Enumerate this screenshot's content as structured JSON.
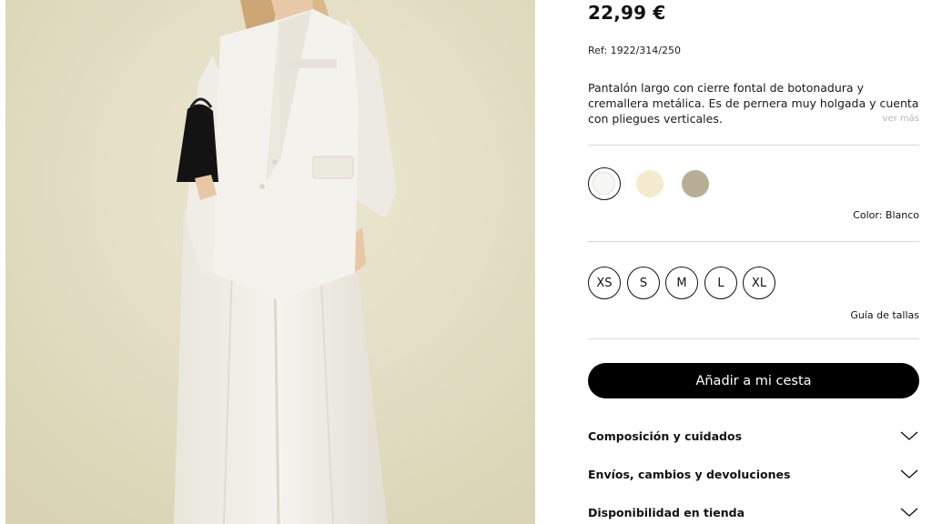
{
  "product": {
    "price": "22,99 €",
    "ref": "Ref: 1922/314/250",
    "description": "Pantalón largo con cierre fontal de botonadura y cremallera metálica. Es de pernera muy holgada y cuenta con pliegues verticales.",
    "read_more": "ver más"
  },
  "colors": {
    "label": "Color: Blanco",
    "swatches": [
      {
        "name": "blanco",
        "hex": "#f7f7f5"
      },
      {
        "name": "crema",
        "hex": "#f3ead0"
      },
      {
        "name": "beige",
        "hex": "#b8ae98"
      }
    ]
  },
  "sizes": {
    "options": [
      "XS",
      "S",
      "M",
      "L",
      "XL"
    ],
    "guide": "Guía de tallas"
  },
  "cart": {
    "add_label": "Añadir a mi cesta"
  },
  "accordions": [
    {
      "label": "Composición y cuidados",
      "icon": "chevron-down-icon"
    },
    {
      "label": "Envíos, cambios y devoluciones",
      "icon": "chevron-down-icon"
    },
    {
      "label": "Disponibilidad en tienda",
      "icon": "chevron-down-icon"
    }
  ],
  "photo": {
    "background": "#e6e1c6",
    "garment": "#f1efe8",
    "bag": "#141414"
  }
}
